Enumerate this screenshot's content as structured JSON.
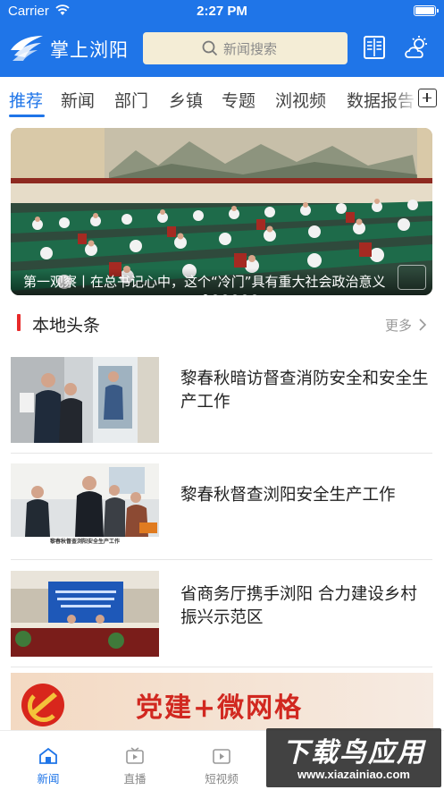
{
  "status_bar": {
    "carrier": "Carrier",
    "time": "2:27 PM"
  },
  "header": {
    "title": "掌上浏阳",
    "search_placeholder": "新闻搜索",
    "accent_color": "#1f75e8"
  },
  "tabs": [
    {
      "label": "推荐",
      "active": true
    },
    {
      "label": "新闻"
    },
    {
      "label": "部门"
    },
    {
      "label": "乡镇"
    },
    {
      "label": "专题"
    },
    {
      "label": "浏视频"
    },
    {
      "label": "数据报告"
    }
  ],
  "banner": {
    "caption": "第一观察丨在总书记心中，这个“冷门”具有重大社会政治意义"
  },
  "section": {
    "title": "本地头条",
    "more_label": "更多"
  },
  "news": [
    {
      "title": "黎春秋暗访督查消防安全和安全生产工作"
    },
    {
      "title": "黎春秋督查浏阳安全生产工作",
      "image_caption": "黎春秋督查浏阳安全生产工作"
    },
    {
      "title": "省商务厅携手浏阳 合力建设乡村振兴示范区"
    }
  ],
  "promo": {
    "text": "党建+微网格"
  },
  "bottom_nav": [
    {
      "label": "新闻",
      "icon": "home-icon",
      "active": true
    },
    {
      "label": "直播",
      "icon": "tv-icon"
    },
    {
      "label": "短视频",
      "icon": "video-icon"
    }
  ],
  "watermark": {
    "main": "下载鸟应用",
    "url": "www.xiazainiao.com"
  }
}
